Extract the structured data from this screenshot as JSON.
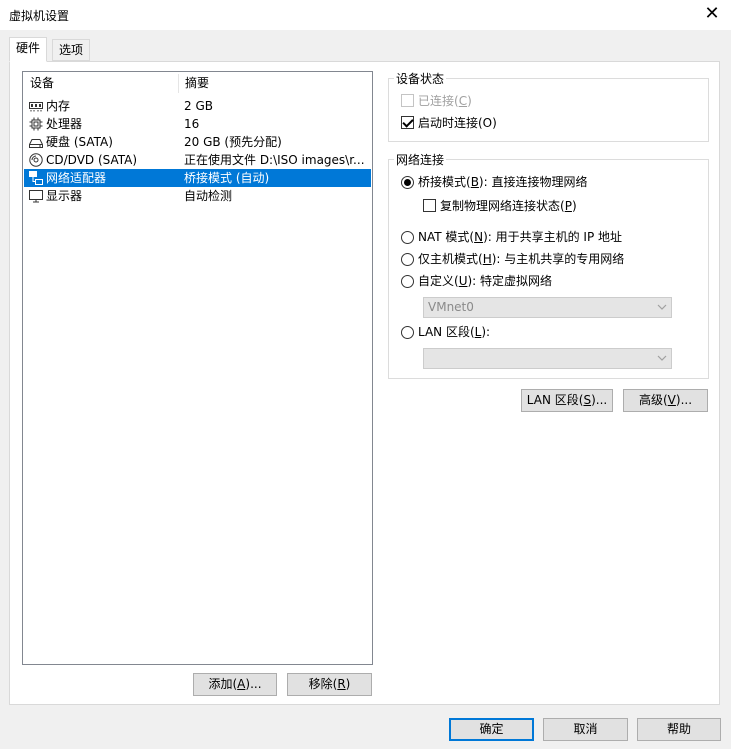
{
  "window": {
    "title": "虚拟机设置"
  },
  "tabs": [
    {
      "label": "硬件"
    },
    {
      "label": "选项"
    }
  ],
  "device_list": {
    "headers": {
      "device": "设备",
      "summary": "摘要"
    },
    "rows": [
      {
        "name": "内存",
        "summary": "2 GB",
        "icon": "memory-icon"
      },
      {
        "name": "处理器",
        "summary": "16",
        "icon": "cpu-icon"
      },
      {
        "name": "硬盘 (SATA)",
        "summary": "20 GB (预先分配)",
        "icon": "hard-disk-icon"
      },
      {
        "name": "CD/DVD (SATA)",
        "summary": "正在使用文件 D:\\ISO images\\r...",
        "icon": "cd-dvd-icon"
      },
      {
        "name": "网络适配器",
        "summary": "桥接模式 (自动)",
        "icon": "network-adapter-icon"
      },
      {
        "name": "显示器",
        "summary": "自动检测",
        "icon": "display-icon"
      }
    ],
    "selected_index": 4
  },
  "buttons": {
    "add": {
      "label": "添加(",
      "key": "A",
      "suffix": ")..."
    },
    "remove": {
      "label": "移除(",
      "key": "R",
      "suffix": ")"
    },
    "lan_segments": {
      "label": "LAN 区段(",
      "key": "S",
      "suffix": ")..."
    },
    "advanced": {
      "label": "高级(",
      "key": "V",
      "suffix": ")..."
    },
    "ok": {
      "label": "确定"
    },
    "cancel": {
      "label": "取消"
    },
    "help": {
      "label": "帮助"
    }
  },
  "device_status": {
    "title": "设备状态",
    "connected": {
      "label": "已连接(",
      "key": "C",
      "suffix": ")",
      "checked": false,
      "enabled": false
    },
    "connect_at_power_on": {
      "label": "启动时连接(O)",
      "checked": true
    }
  },
  "network_connection": {
    "title": "网络连接",
    "bridged": {
      "label_a": "桥接模式(",
      "key": "B",
      "label_b": "): 直接连接物理网络",
      "checked": true
    },
    "replicate": {
      "label_a": "复制物理网络连接状态(",
      "key": "P",
      "label_b": ")",
      "checked": false
    },
    "nat": {
      "label_a": "NAT 模式(",
      "key": "N",
      "label_b": "): 用于共享主机的 IP 地址",
      "checked": false
    },
    "host_only": {
      "label_a": "仅主机模式(",
      "key": "H",
      "label_b": "): 与主机共享的专用网络",
      "checked": false
    },
    "custom": {
      "label_a": "自定义(",
      "key": "U",
      "label_b": "): 特定虚拟网络",
      "checked": false
    },
    "custom_select": {
      "value": "VMnet0"
    },
    "lan_segment": {
      "label_a": "LAN 区段(",
      "key": "L",
      "label_b": "):",
      "checked": false
    },
    "lan_select": {
      "value": ""
    }
  }
}
